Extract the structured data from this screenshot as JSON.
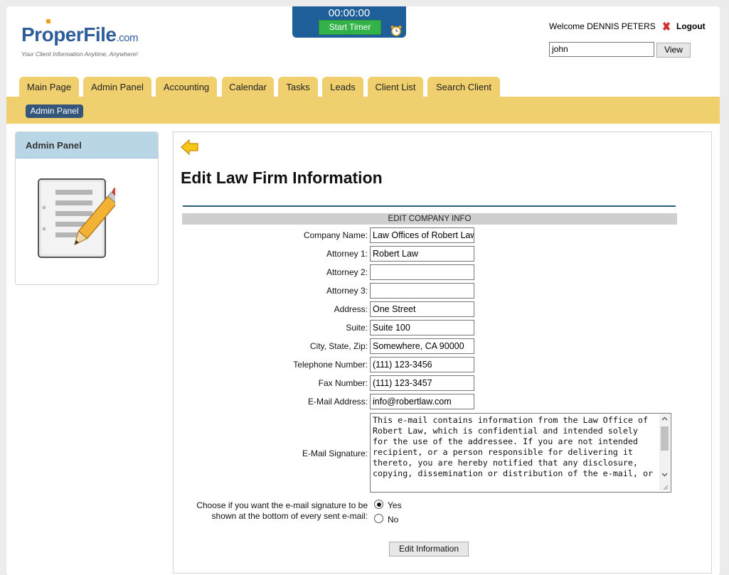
{
  "brand": {
    "logo_text_left": "Pr",
    "logo_text_o": "o",
    "logo_text_right": "perFile",
    "logo_com": ".com",
    "tagline": "Your Client Information Anytime, Anywhere!"
  },
  "timer": {
    "display": "00:00:00",
    "start_label": "Start Timer"
  },
  "user": {
    "welcome": "Welcome DENNIS PETERS",
    "logout_label": "Logout"
  },
  "search": {
    "value": "john",
    "view_label": "View"
  },
  "nav": {
    "tabs": [
      {
        "label": "Main Page"
      },
      {
        "label": "Admin Panel"
      },
      {
        "label": "Accounting"
      },
      {
        "label": "Calendar"
      },
      {
        "label": "Tasks"
      },
      {
        "label": "Leads"
      },
      {
        "label": "Client List"
      },
      {
        "label": "Search Client"
      }
    ],
    "subtab": "Admin Panel"
  },
  "sidebar": {
    "title": "Admin Panel"
  },
  "main": {
    "title": "Edit Law Firm Information",
    "section_header": "EDIT COMPANY INFO",
    "fields": [
      {
        "label": "Company Name:",
        "value": "Law Offices of Robert Law"
      },
      {
        "label": "Attorney 1:",
        "value": "Robert Law"
      },
      {
        "label": "Attorney 2:",
        "value": ""
      },
      {
        "label": "Attorney 3:",
        "value": ""
      },
      {
        "label": "Address:",
        "value": "One Street"
      },
      {
        "label": "Suite:",
        "value": "Suite 100"
      },
      {
        "label": "City, State, Zip:",
        "value": "Somewhere, CA 90000"
      },
      {
        "label": "Telephone Number:",
        "value": "(111) 123-3456"
      },
      {
        "label": "Fax Number:",
        "value": "(111) 123-3457"
      },
      {
        "label": "E-Mail Address:",
        "value": "info@robertlaw.com"
      }
    ],
    "signature_label": "E-Mail Signature:",
    "signature_text": "This e-mail contains information from the Law Office of Robert Law, which is confidential and intended solely for the use of the addressee. If you are not intended recipient, or a person responsible for delivering it thereto, you are hereby notified that any disclosure, copying, dissemination or distribution of the e-mail, or",
    "show_sig_label_1": "Choose if you want the e-mail signature to be",
    "show_sig_label_2": "shown at the bottom of every sent e-mail:",
    "option_yes": "Yes",
    "option_no": "No",
    "submit_label": "Edit Information"
  }
}
